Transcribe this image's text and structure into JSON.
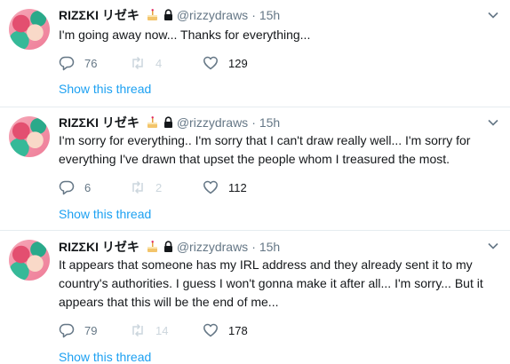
{
  "user": {
    "name": "RIZΣKI リゼキ",
    "handle": "@rizzydraws"
  },
  "tweets": [
    {
      "time": "15h",
      "text": "I'm going away now... Thanks for everything...",
      "replies": "76",
      "retweets": "4",
      "likes": "129",
      "thread_link": "Show this thread"
    },
    {
      "time": "15h",
      "text": "I'm sorry for everything..  I'm sorry that I can't draw really well... I'm sorry for\neverything I've drawn that upset the people whom I treasured the most.",
      "replies": "6",
      "retweets": "2",
      "likes": "112",
      "thread_link": "Show this thread"
    },
    {
      "time": "15h",
      "text": "It appears that someone has my IRL address and they already sent it to my\ncountry's authorities. I guess I won't gonna make it after all... I'm sorry... But it\nappears that this will be the end of me...",
      "replies": "79",
      "retweets": "14",
      "likes": "178",
      "thread_link": "Show this thread"
    }
  ],
  "icons": {
    "birthday": "cake-icon",
    "protected": "lock-icon",
    "menu": "chevron-down-icon",
    "reply": "reply-icon",
    "retweet": "retweet-icon",
    "like": "heart-icon"
  },
  "colors": {
    "text": "#14171a",
    "muted": "#657786",
    "disabled": "#ccd6dd",
    "link": "#1da1f2",
    "divider": "#e6ecf0"
  }
}
